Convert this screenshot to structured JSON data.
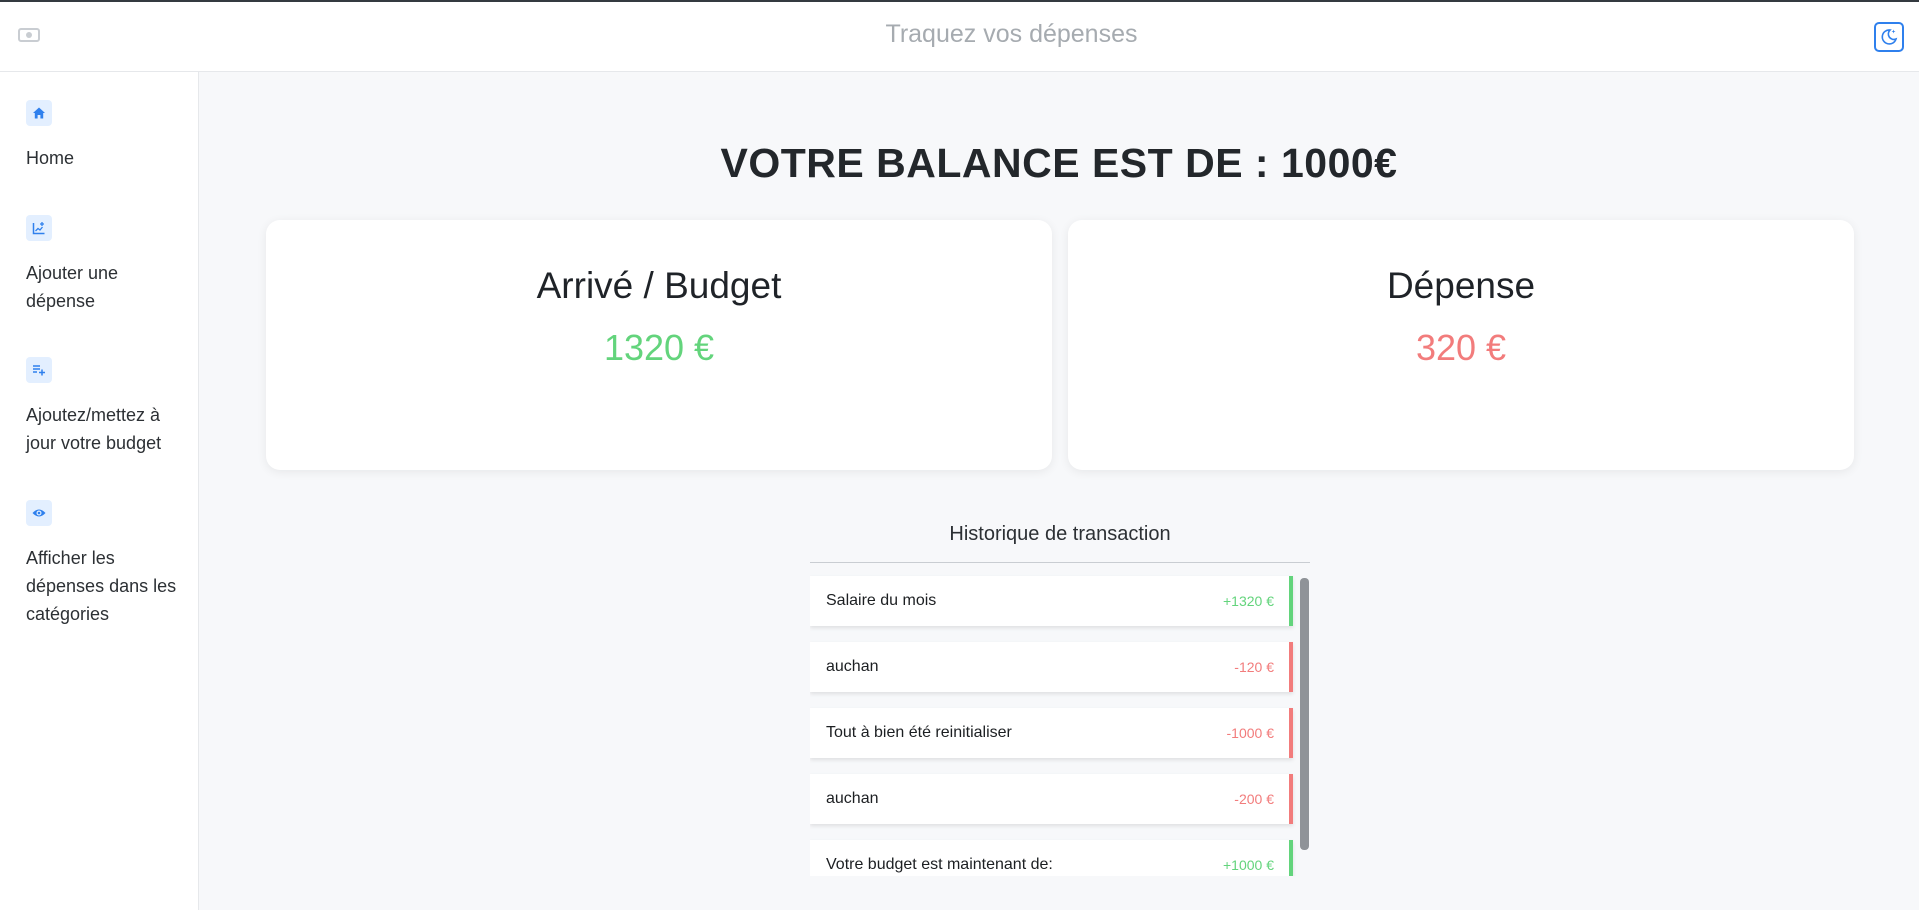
{
  "header": {
    "title": "Traquez vos dépenses",
    "logo_icon": "money-icon",
    "theme_icon": "moon-stars-icon"
  },
  "sidebar": {
    "items": [
      {
        "label": "Home",
        "icon": "home-icon"
      },
      {
        "label": "Ajouter une dépense",
        "icon": "chart-add-icon"
      },
      {
        "label": "Ajoutez/mettez à jour votre budget",
        "icon": "playlist-add-icon"
      },
      {
        "label": "Afficher les dépenses dans les catégories",
        "icon": "eye-icon"
      }
    ]
  },
  "main": {
    "balance_text": "VOTRE BALANCE EST DE : 1000€",
    "cards": [
      {
        "title": "Arrivé / Budget",
        "amount": "1320 €"
      },
      {
        "title": "Dépense",
        "amount": "320 €"
      }
    ],
    "history": {
      "title": "Historique de transaction",
      "items": [
        {
          "label": "Salaire du mois",
          "amount": "+1320 €",
          "type": "income"
        },
        {
          "label": "auchan",
          "amount": "-120 €",
          "type": "expense"
        },
        {
          "label": "Tout à bien été reinitialiser",
          "amount": "-1000 €",
          "type": "expense"
        },
        {
          "label": "auchan",
          "amount": "-200 €",
          "type": "expense"
        },
        {
          "label": "Votre budget est maintenant de:",
          "amount": "+1000 €",
          "type": "income"
        }
      ]
    }
  },
  "colors": {
    "accent": "#2f80ed",
    "income": "#63d47c",
    "expense": "#f27c7c"
  }
}
